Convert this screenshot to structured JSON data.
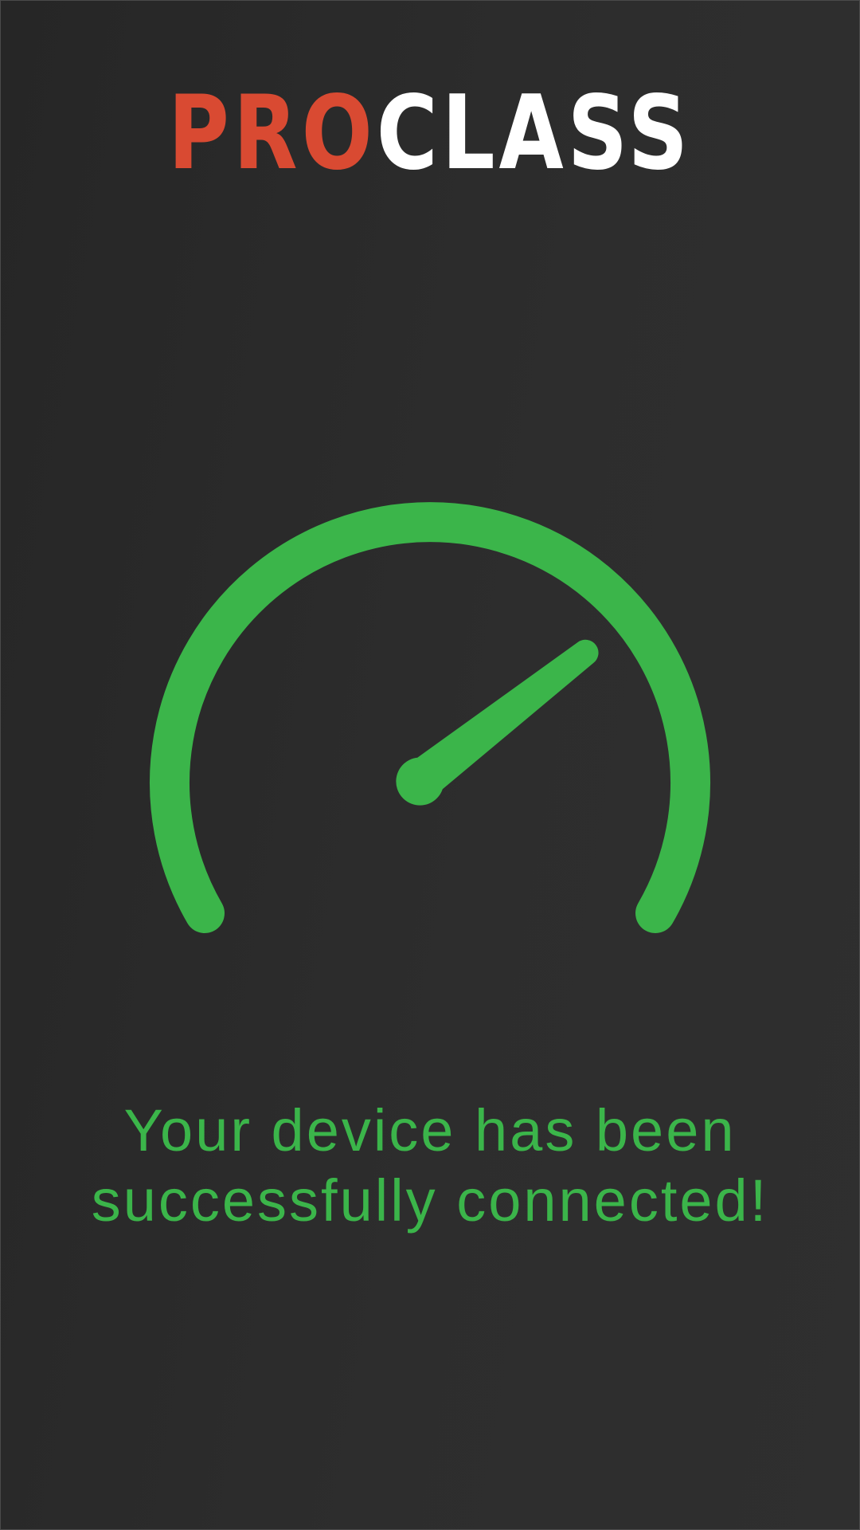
{
  "app": {
    "logo_part_1": "PRO",
    "logo_part_2": "CLASS"
  },
  "status": {
    "message": "Your device has been successfully connected!",
    "gauge_level": 0.72
  },
  "icons": {
    "gauge": "speedometer-icon"
  },
  "colors": {
    "accent_green": "#3bb54a",
    "logo_red": "#d94a32",
    "logo_white": "#ffffff",
    "background": "#2b2b2b"
  }
}
